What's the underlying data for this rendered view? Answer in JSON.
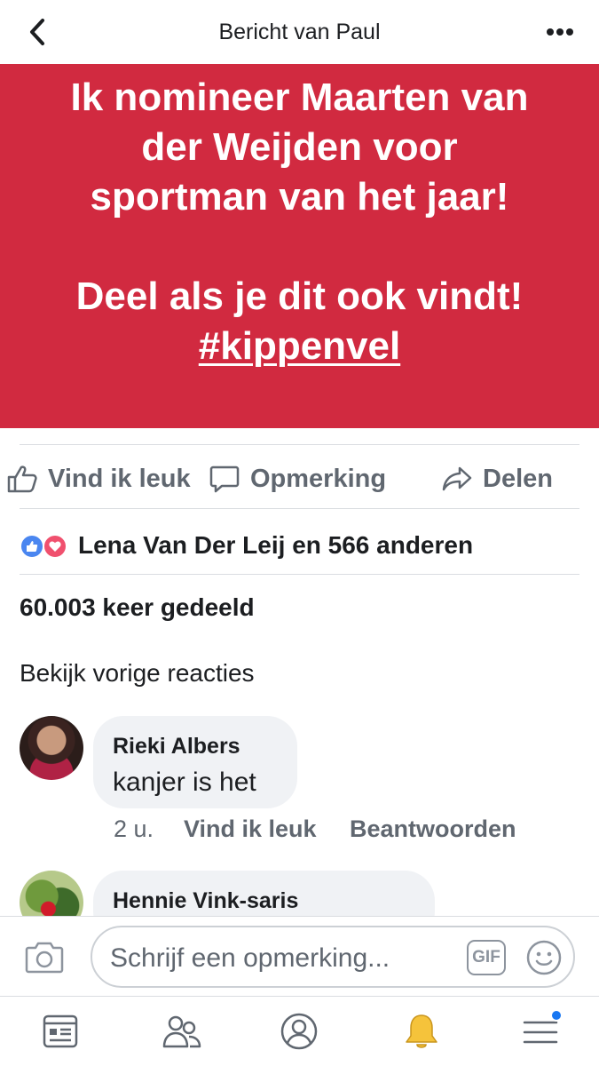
{
  "header": {
    "title": "Bericht van Paul",
    "back_icon": "chevron-left-icon",
    "more_icon": "more-dots-icon"
  },
  "post": {
    "background_color": "#d12a40",
    "lines": [
      "Ik nomineer Maarten van",
      "der Weijden voor",
      "sportman van het jaar!"
    ],
    "line2": "Deel als je dit ook vindt!",
    "hashtag": "#kippenvel"
  },
  "actions": {
    "like": "Vind ik leuk",
    "comment": "Opmerking",
    "share": "Delen"
  },
  "reactions": {
    "summary": "Lena Van Der Leij en 566 anderen",
    "types": [
      "like",
      "love"
    ]
  },
  "shares": "60.003 keer gedeeld",
  "previous_comments": "Bekijk vorige reacties",
  "comments": [
    {
      "author": "Rieki Albers",
      "text": "kanjer is het",
      "time": "2 u.",
      "like": "Vind ik leuk",
      "reply": "Beantwoorden"
    },
    {
      "author": "Hennie Vink-saris"
    }
  ],
  "compose": {
    "placeholder": "Schrijf een opmerking...",
    "gif": "GIF"
  },
  "bottom_nav": [
    {
      "icon": "news-feed-icon"
    },
    {
      "icon": "friends-icon"
    },
    {
      "icon": "profile-icon"
    },
    {
      "icon": "bell-icon",
      "active": true
    },
    {
      "icon": "menu-icon",
      "badge": true
    }
  ]
}
